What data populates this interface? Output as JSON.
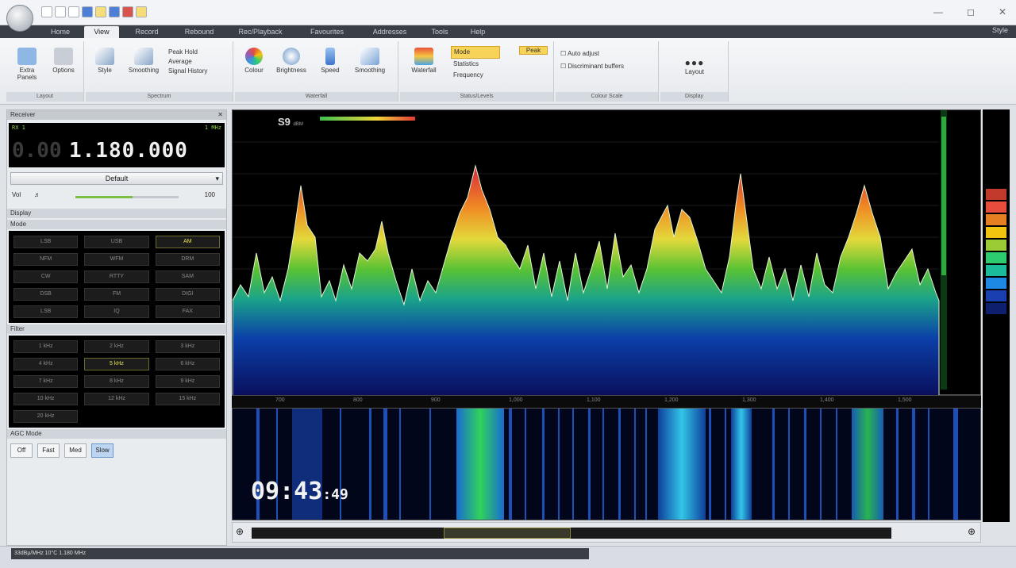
{
  "quick_access_icons": [
    "new-icon",
    "open-icon",
    "save-icon",
    "settings-icon",
    "favorite-icon",
    "undo-icon",
    "redo-icon",
    "folder-icon"
  ],
  "tabs": [
    {
      "label": "Home"
    },
    {
      "label": "View"
    },
    {
      "label": "Record"
    },
    {
      "label": "Rebound"
    },
    {
      "label": "Rec/Playback"
    },
    {
      "label": "Favourites"
    },
    {
      "label": "Addresses"
    },
    {
      "label": "Tools"
    },
    {
      "label": "Help"
    }
  ],
  "active_tab": "View",
  "tabs_right": "Style",
  "ribbon": {
    "groups": [
      {
        "title": "Layout",
        "buttons": [
          "Extra Panels",
          "Options"
        ]
      },
      {
        "title": "Spectrum",
        "buttons": [
          "Style",
          "Smoothing",
          "Signal History",
          "Peak Hold",
          "Average"
        ]
      },
      {
        "title": "Waterfall",
        "buttons": [
          "Colour",
          "Brightness",
          "Speed",
          "Smoothing"
        ]
      },
      {
        "title": "Status/Levels",
        "buttons": [
          "Waterfall",
          "Mode",
          "Statistics",
          "Frequency",
          "Peak"
        ]
      },
      {
        "title": "Colour Scale",
        "buttons": [
          "Auto adjust",
          "Discriminant buffers"
        ]
      },
      {
        "title": "Display",
        "buttons": [
          "Layout"
        ]
      }
    ]
  },
  "left_panel": {
    "title": "Receiver",
    "vfo_left": "RX 1",
    "vfo_right": "1 MHz",
    "freq_dim": "0.00",
    "freq_main": "1.180.000",
    "preset": "Default",
    "slider_label": "Vol",
    "slider_value": "100",
    "slider_level": 0.55,
    "display_label": "Display",
    "mode_title": "Mode",
    "mode_buttons": [
      "LSB",
      "USB",
      "AM",
      "NFM",
      "WFM",
      "DRM",
      "CW",
      "RTTY",
      "SAM",
      "DSB",
      "FM",
      "DIGI",
      "LSB",
      "IQ",
      "FAX"
    ],
    "mode_selected_index": 2,
    "filter_title": "Filter",
    "filter_buttons": [
      "1 kHz",
      "2 kHz",
      "3 kHz",
      "4 kHz",
      "5 kHz",
      "6 kHz",
      "7 kHz",
      "8 kHz",
      "9 kHz",
      "10 kHz",
      "12 kHz",
      "15 kHz",
      "20 kHz"
    ],
    "filter_selected_index": 4,
    "agc_title": "AGC Mode",
    "agc_buttons": [
      "Off",
      "Fast",
      "Med",
      "Slow"
    ],
    "agc_selected_index": 3
  },
  "spectrum": {
    "smeter": "S9",
    "smeter_unit": "dBM",
    "ruler_labels": [
      "700",
      "800",
      "900",
      "1,000",
      "1,100",
      "1,200",
      "1,300",
      "1,400",
      "1,500"
    ]
  },
  "clock": {
    "hhmm": "09:43",
    "ss": "49"
  },
  "status": {
    "text": "33dBμ/MHz 10°C 1.180 MHz"
  },
  "colors": {
    "spectrum_bg": "#000000",
    "accent": "#e8e34f",
    "selected_tab_bg": "#eef0f3"
  }
}
